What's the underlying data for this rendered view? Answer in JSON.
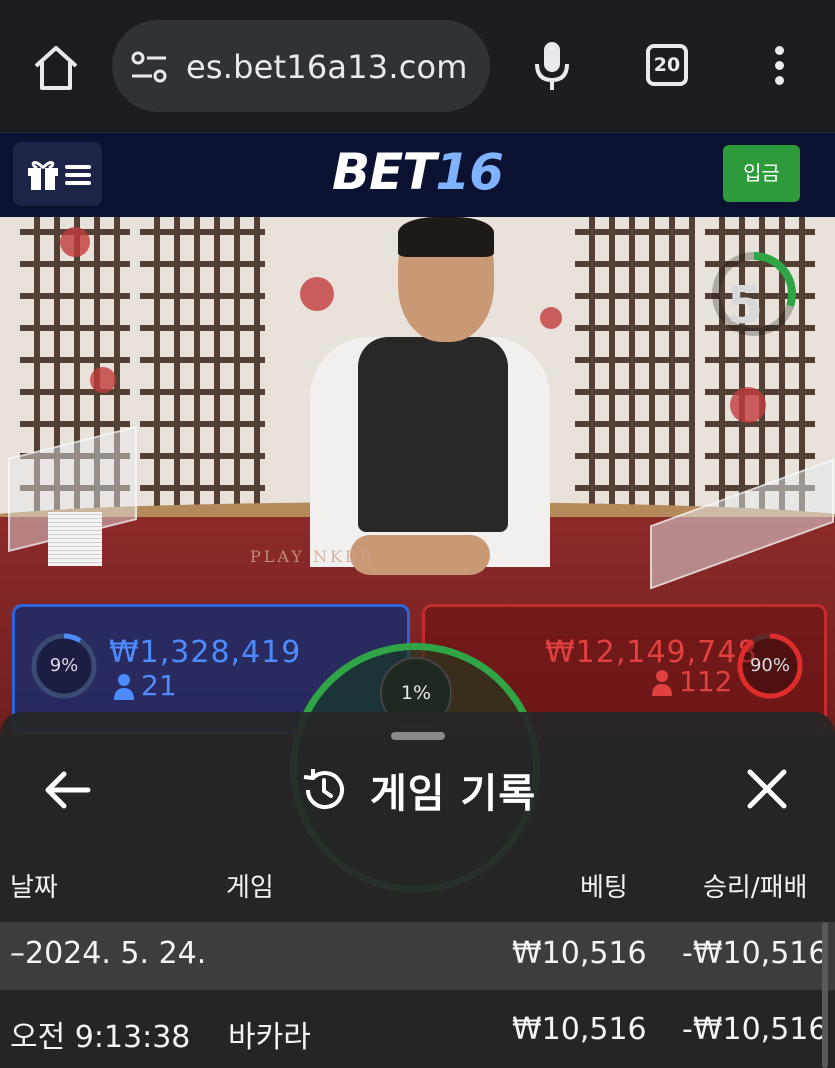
{
  "browser": {
    "url": "es.bet16a13.com",
    "tab_count": "20",
    "icons": [
      "home-icon",
      "site-settings-icon",
      "mic-icon",
      "tab-switcher-icon",
      "more-vert-icon"
    ]
  },
  "site": {
    "logo_part1": "BET",
    "logo_part2": "16",
    "deposit_label": "입금",
    "menu_icons": [
      "gift-icon",
      "hamburger-icon"
    ],
    "colors": {
      "header_bg": "#0b1231",
      "deposit_green": "#2e9b3b",
      "logo_blue": "#7fb3ff"
    }
  },
  "game": {
    "countdown": "5",
    "countdown_fraction": 0.3,
    "table_text": "PLAY            NKER",
    "player": {
      "percent": "9%",
      "percent_value": 0.09,
      "amount": "₩1,328,419",
      "count": "21"
    },
    "banker": {
      "percent": "90%",
      "percent_value": 0.9,
      "amount": "₩12,149,748",
      "count": "112"
    },
    "tie": {
      "percent": "1%",
      "percent_value": 0.01
    },
    "colors": {
      "player": "#2f63d8",
      "banker": "#c22c2c",
      "tie": "#2fa546"
    }
  },
  "history": {
    "title": "게임 기록",
    "columns": {
      "date": "날짜",
      "game": "게임",
      "bet": "베팅",
      "result": "승리/패배"
    },
    "summary": {
      "date": "–2024. 5. 24.",
      "game": "",
      "bet": "₩10,516",
      "result": "-₩10,516"
    },
    "rows": [
      {
        "time": "오전 9:13:38",
        "game": "바카라",
        "bet": "₩10,516",
        "result": "-₩10,516"
      }
    ]
  }
}
